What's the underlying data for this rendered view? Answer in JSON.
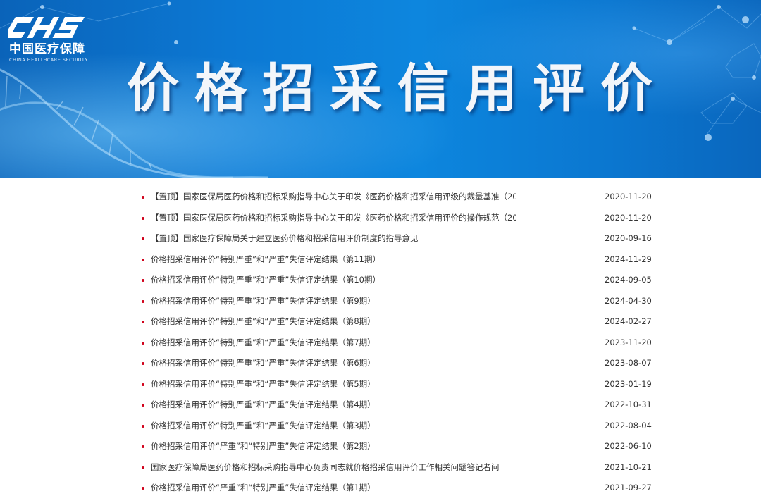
{
  "banner": {
    "title": "价格招采信用评价",
    "logo": {
      "mark": "CHS",
      "name_cn": "中国医疗保障",
      "name_en": "CHINA HEALTHCARE SECURITY"
    },
    "colors": {
      "background": "#0c78d3",
      "title": "#f3f6fa"
    }
  },
  "list": {
    "bullet_color": "#d0021b",
    "items": [
      {
        "title": "【置顶】国家医保局医药价格和招标采购指导中心关于印发《医药价格和招采信用评级的裁量基准（20...",
        "date": "2020-11-20"
      },
      {
        "title": "【置顶】国家医保局医药价格和招标采购指导中心关于印发《医药价格和招采信用评价的操作规范（20...",
        "date": "2020-11-20"
      },
      {
        "title": "【置顶】国家医疗保障局关于建立医药价格和招采信用评价制度的指导意见",
        "date": "2020-09-16"
      },
      {
        "title": "价格招采信用评价“特别严重”和“严重”失信评定结果（第11期）",
        "date": "2024-11-29"
      },
      {
        "title": "价格招采信用评价“特别严重”和“严重”失信评定结果（第10期）",
        "date": "2024-09-05"
      },
      {
        "title": "价格招采信用评价“特别严重”和“严重”失信评定结果（第9期）",
        "date": "2024-04-30"
      },
      {
        "title": "价格招采信用评价“特别严重”和“严重”失信评定结果（第8期）",
        "date": "2024-02-27"
      },
      {
        "title": "价格招采信用评价“特别严重”和“严重”失信评定结果（第7期）",
        "date": "2023-11-20"
      },
      {
        "title": "价格招采信用评价“特别严重”和“严重”失信评定结果（第6期）",
        "date": "2023-08-07"
      },
      {
        "title": "价格招采信用评价“特别严重”和“严重”失信评定结果（第5期）",
        "date": "2023-01-19"
      },
      {
        "title": "价格招采信用评价“特别严重”和“严重”失信评定结果（第4期）",
        "date": "2022-10-31"
      },
      {
        "title": "价格招采信用评价“特别严重”和“严重”失信评定结果（第3期）",
        "date": "2022-08-04"
      },
      {
        "title": "价格招采信用评价“严重”和“特别严重”失信评定结果（第2期）",
        "date": "2022-06-10"
      },
      {
        "title": "国家医疗保障局医药价格和招标采购指导中心负责同志就价格招采信用评价工作相关问题答记者问",
        "date": "2021-10-21"
      },
      {
        "title": "价格招采信用评价“严重”和“特别严重”失信评定结果（第1期）",
        "date": "2021-09-27"
      }
    ]
  }
}
